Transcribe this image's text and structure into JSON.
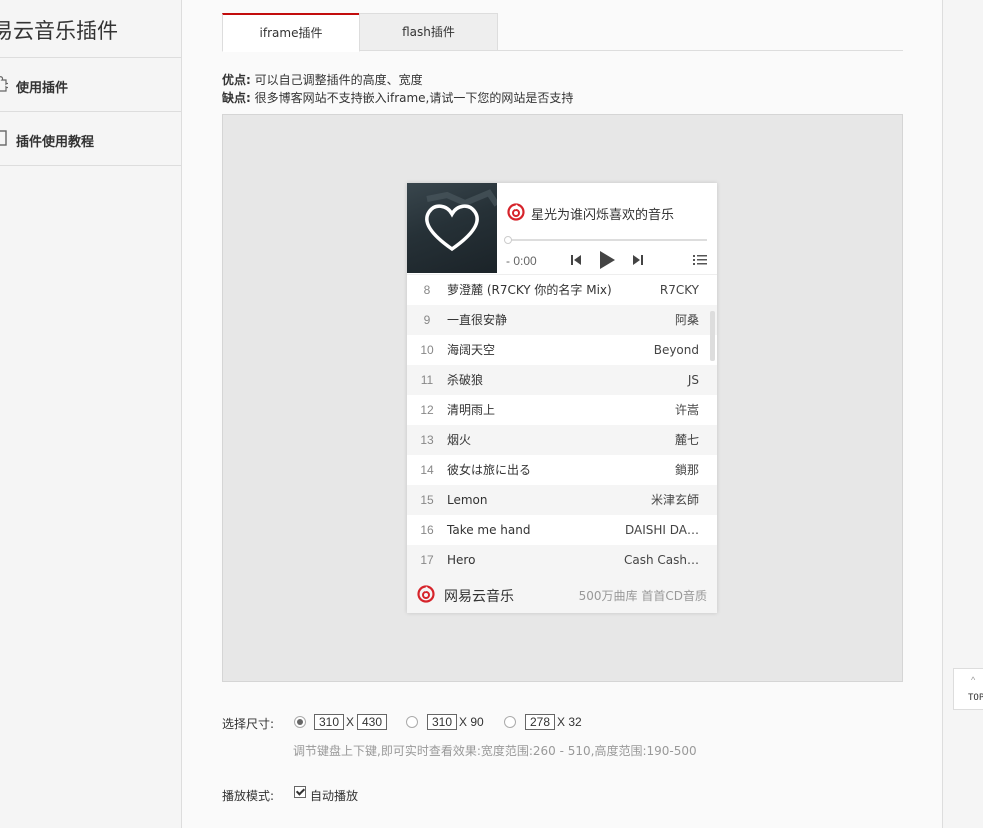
{
  "sidebar": {
    "brand": "易云音乐插件",
    "items": [
      {
        "label": "使用插件"
      },
      {
        "label": "插件使用教程"
      }
    ]
  },
  "tabs": [
    {
      "label": "iframe插件",
      "active": true
    },
    {
      "label": "flash插件",
      "active": false
    }
  ],
  "notes": {
    "pros_label": "优点:",
    "pros_text": "可以自己调整插件的高度、宽度",
    "cons_label": "缺点:",
    "cons_text": "很多博客网站不支持嵌入iframe,请试一下您的网站是否支持"
  },
  "player": {
    "title": "星光为谁闪烁喜欢的音乐",
    "time": "- 0:00",
    "songs": [
      {
        "num": "8",
        "title": "萝澄麓 (R7CKY 你的名字 Mix)",
        "artist": "R7CKY"
      },
      {
        "num": "9",
        "title": "一直很安静",
        "artist": "阿桑"
      },
      {
        "num": "10",
        "title": "海阔天空",
        "artist": "Beyond"
      },
      {
        "num": "11",
        "title": "杀破狼",
        "artist": "JS"
      },
      {
        "num": "12",
        "title": "清明雨上",
        "artist": "许嵩"
      },
      {
        "num": "13",
        "title": "烟火",
        "artist": "麓七"
      },
      {
        "num": "14",
        "title": "彼女は旅に出る",
        "artist": "鎖那"
      },
      {
        "num": "15",
        "title": "Lemon",
        "artist": "米津玄師"
      },
      {
        "num": "16",
        "title": "Take me hand",
        "artist": "DAISHI DA…"
      },
      {
        "num": "17",
        "title": "Hero",
        "artist": "Cash Cash…"
      }
    ],
    "footer_name": "网易云音乐",
    "footer_slogan": "500万曲库 首首CD音质"
  },
  "size": {
    "label": "选择尺寸:",
    "options": [
      {
        "w": "310",
        "h": "430",
        "checked": true
      },
      {
        "w": "310",
        "h": "90",
        "checked": false
      },
      {
        "w": "278",
        "h": "32",
        "checked": false
      }
    ],
    "x": "X",
    "x_90": "X 90",
    "x_32": "X 32",
    "hint": "调节键盘上下键,即可实时查看效果:宽度范围:260 - 510,高度范围:190-500"
  },
  "mode": {
    "label": "播放模式:",
    "autoplay_label": "自动播放",
    "autoplay": true
  },
  "top_button": {
    "label": "TOP"
  },
  "colors": {
    "accent": "#c20c0c",
    "netease_red": "#d6242b"
  },
  "icons": [
    "puzzle-icon",
    "document-icon",
    "heart-icon",
    "netease-logo-icon",
    "prev-icon",
    "play-icon",
    "next-icon",
    "playlist-icon",
    "arrow-up-icon"
  ]
}
